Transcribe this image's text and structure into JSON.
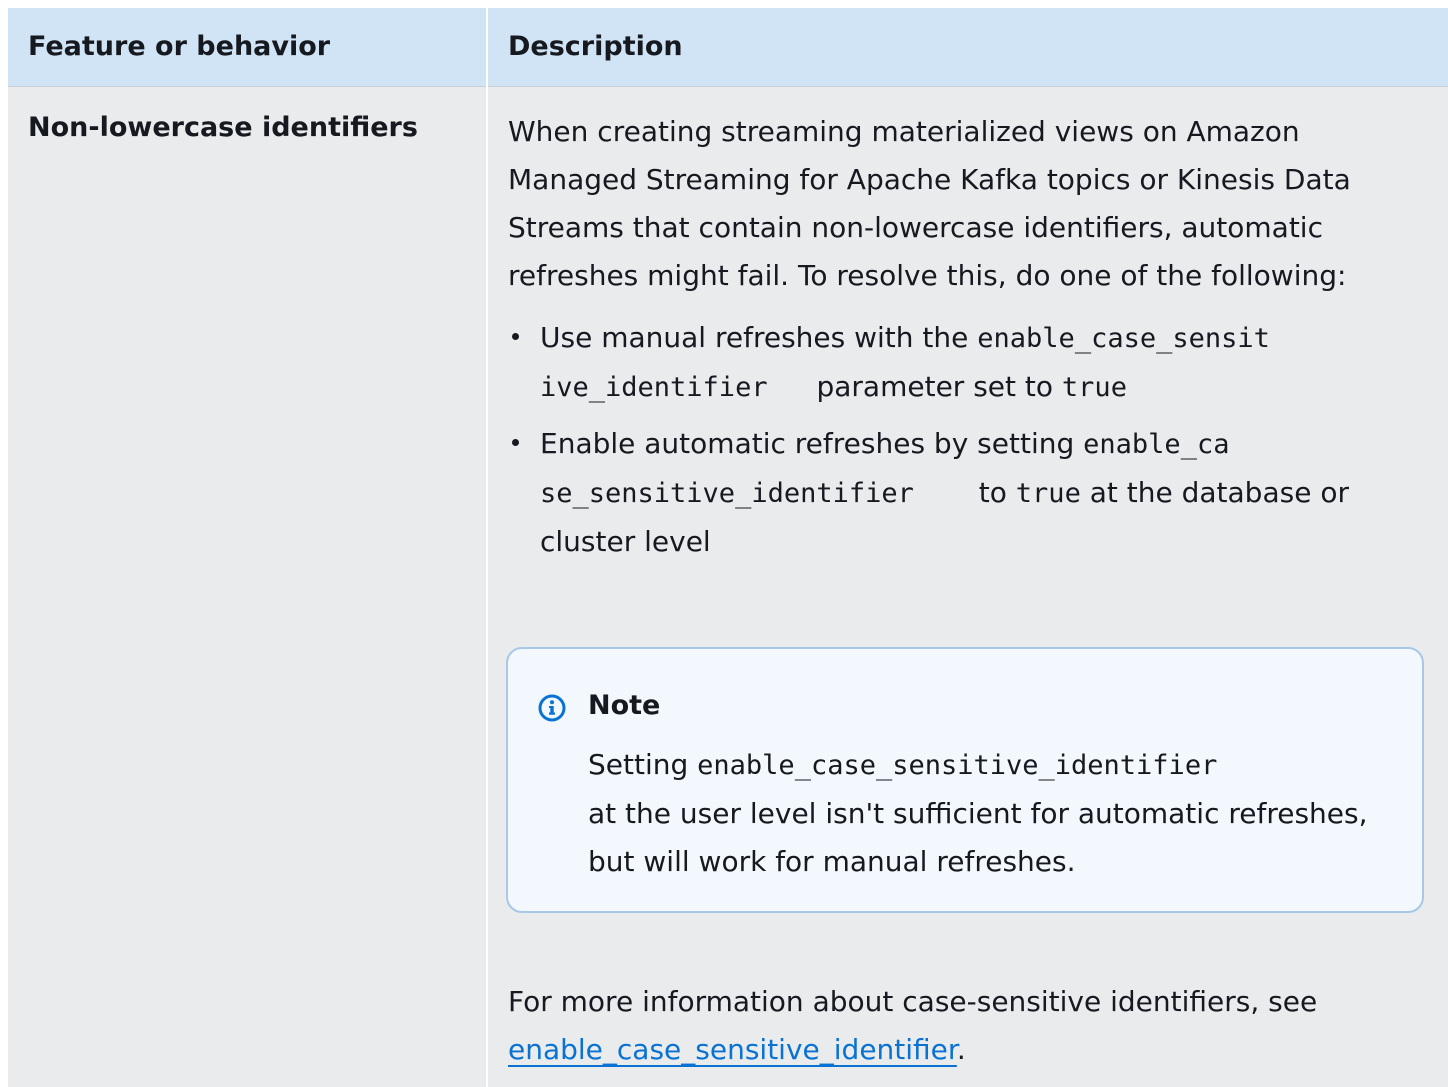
{
  "table": {
    "headers": {
      "feature": "Feature or behavior",
      "description": "Description"
    },
    "row": {
      "feature": "Non-lowercase identifiers",
      "intro": "When creating streaming materialized views on Amazon Managed Streaming for Apache Kafka topics or Kinesis Data Streams that contain non-lowercase identifiers, automatic refreshes might fail. To resolve this, do one of the following:",
      "bullet1": {
        "prefix": "Use manual refreshes with the ",
        "code1a": "enable_case_sensit",
        "code1b": "ive_identifier",
        "mid": "parameter set to ",
        "code2": "true"
      },
      "bullet2": {
        "prefix": "Enable automatic refreshes by setting ",
        "code1a": "enable_ca",
        "code1b": "se_sensitive_identifier",
        "mid": "to ",
        "code2": "true",
        "suffix": " at the database or cluster level"
      },
      "note": {
        "icon": "info-icon",
        "title": "Note",
        "prefix": "Setting ",
        "code": "enable_case_sensitive_identifier",
        "suffix": "at the user level isn't sufficient for automatic refreshes, but will work for manual refreshes."
      },
      "more": {
        "prefix": "For more information about case-sensitive identifiers, see ",
        "link": "enable_case_sensitive_identifier",
        "suffix": "."
      }
    }
  },
  "colors": {
    "header_bg": "#d1e4f6",
    "cell_bg": "#e9ebed",
    "note_bg": "#f2f8fd",
    "note_border": "#a8c8e8",
    "link": "#0972d3",
    "info_icon": "#0972d3"
  }
}
